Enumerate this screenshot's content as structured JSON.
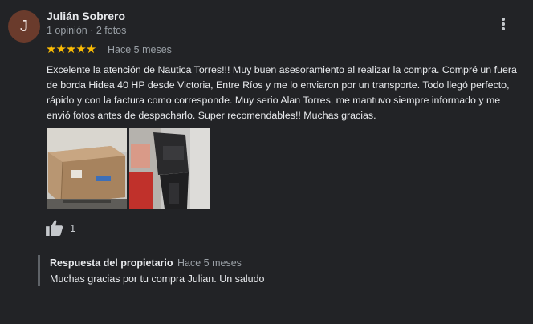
{
  "review": {
    "avatar_letter": "J",
    "avatar_color": "#6a3b2c",
    "author": "Julián Sobrero",
    "author_meta": "1 opinión · 2 fotos",
    "rating": 5,
    "stars": "★★★★★",
    "star_color": "#fbbc04",
    "time": "Hace 5 meses",
    "text": "Excelente la atención de Nautica Torres!!! Muy buen asesoramiento al realizar la compra. Compré un fuera de borda Hidea 40 HP desde Victoria, Entre Ríos y me lo enviaron por un transporte. Todo llegó perfecto, rápido y con la factura como corresponde. Muy serio Alan Torres, me mantuvo siempre informado y me envió fotos antes de despacharlo. Super recomendables!! Muchas gracias.",
    "photos": [
      {
        "icon": "photo-boxed-motor"
      },
      {
        "icon": "photo-outboard-motor"
      }
    ],
    "likes": "1",
    "menu_icon": "more-vert-icon"
  },
  "owner_response": {
    "title": "Respuesta del propietario",
    "time": "Hace 5 meses",
    "text": "Muchas gracias por tu compra Julian. Un saludo"
  }
}
